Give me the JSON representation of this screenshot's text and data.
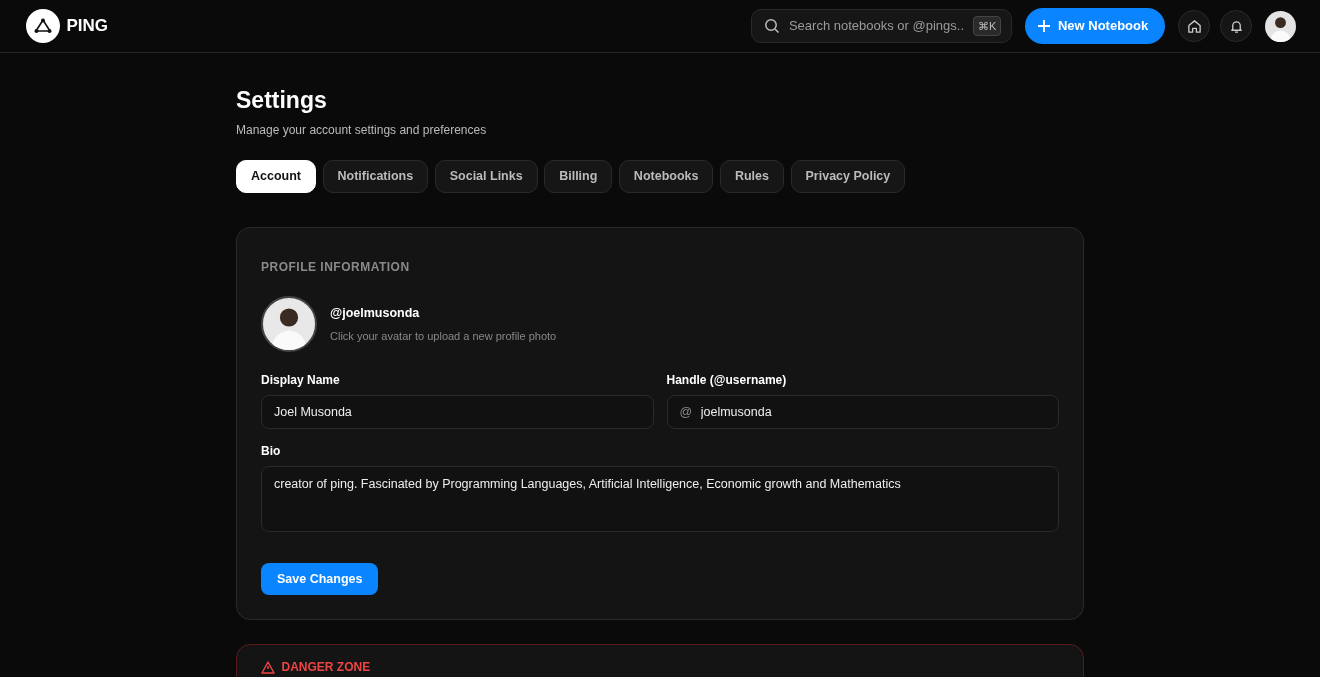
{
  "brand": {
    "name": "PING"
  },
  "search": {
    "placeholder": "Search notebooks or @pings...",
    "shortcut": "⌘K"
  },
  "new_button": {
    "label": "New Notebook"
  },
  "page": {
    "title": "Settings",
    "subtitle": "Manage your account settings and preferences"
  },
  "tabs": [
    {
      "label": "Account",
      "selected": true
    },
    {
      "label": "Notifications",
      "selected": false
    },
    {
      "label": "Social Links",
      "selected": false
    },
    {
      "label": "Billing",
      "selected": false
    },
    {
      "label": "Notebooks",
      "selected": false
    },
    {
      "label": "Rules",
      "selected": false
    },
    {
      "label": "Privacy Policy",
      "selected": false
    }
  ],
  "profile": {
    "heading": "PROFILE INFORMATION",
    "handle": "@joelmusonda",
    "hint": "Click your avatar to upload a new profile photo",
    "display_name": {
      "label": "Display Name",
      "value": "Joel Musonda"
    },
    "username": {
      "label": "Handle (@username)",
      "prefix": "@",
      "value": "joelmusonda"
    },
    "bio": {
      "label": "Bio",
      "value": "creator of ping. Fascinated by Programming Languages, Artificial Intelligence, Economic growth and Mathematics"
    },
    "save_button": "Save Changes"
  },
  "danger": {
    "heading": "DANGER ZONE"
  }
}
